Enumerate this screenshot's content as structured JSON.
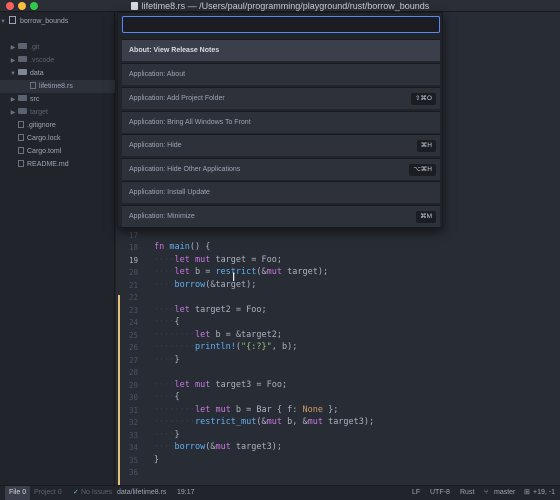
{
  "window": {
    "title": "lifetime8.rs — /Users/paul/programming/playground/rust/borrow_bounds"
  },
  "tree": {
    "root": "borrow_bounds",
    "items": [
      {
        "label": ".git",
        "kind": "folder",
        "dim": true,
        "expanded": false
      },
      {
        "label": ".vscode",
        "kind": "folder",
        "dim": true,
        "expanded": false
      },
      {
        "label": "data",
        "kind": "folder",
        "dim": false,
        "expanded": true
      },
      {
        "label": "lifetime8.rs",
        "kind": "file",
        "dim": false,
        "selected": true
      },
      {
        "label": "src",
        "kind": "folder",
        "dim": false,
        "expanded": false
      },
      {
        "label": "target",
        "kind": "folder",
        "dim": true,
        "expanded": false
      },
      {
        "label": ".gitignore",
        "kind": "file",
        "dim": false
      },
      {
        "label": "Cargo.lock",
        "kind": "file",
        "dim": false
      },
      {
        "label": "Cargo.toml",
        "kind": "file",
        "dim": false
      },
      {
        "label": "README.md",
        "kind": "file",
        "dim": false
      }
    ]
  },
  "palette": {
    "query": "",
    "commands": [
      {
        "label": "About: View Release Notes",
        "shortcut": "",
        "selected": true
      },
      {
        "label": "Application: About",
        "shortcut": ""
      },
      {
        "label": "Application: Add Project Folder",
        "shortcut": "⇧⌘O"
      },
      {
        "label": "Application: Bring All Windows To Front",
        "shortcut": ""
      },
      {
        "label": "Application: Hide",
        "shortcut": "⌘H"
      },
      {
        "label": "Application: Hide Other Applications",
        "shortcut": "⌥⌘H"
      },
      {
        "label": "Application: Install Update",
        "shortcut": ""
      },
      {
        "label": "Application: Minimize",
        "shortcut": "⌘M"
      }
    ]
  },
  "editor": {
    "gutter": [
      "17",
      "18",
      "19",
      "20",
      "21",
      "22",
      "23",
      "24",
      "25",
      "26",
      "27",
      "28",
      "29",
      "30",
      "31",
      "32",
      "33",
      "34",
      "35",
      "36",
      "37"
    ],
    "current_line": "19",
    "lines": [
      "",
      "fn main() {",
      "    let mut target = Foo;",
      "    let b = restrict(&mut target);",
      "    borrow(&target);",
      "",
      "    let target2 = Foo;",
      "    {",
      "        let b = &target2;",
      "        println!(\"{:?}\", b);",
      "    }",
      "",
      "    let mut target3 = Foo;",
      "    {",
      "        let mut b = Bar { f: None };",
      "        restrict_mut(&mut b, &mut target3);",
      "    }",
      "    borrow(&mut target3);",
      "}",
      "",
      ""
    ]
  },
  "statusbar": {
    "file": "File 0",
    "project": "Project 0",
    "issues": "No Issues",
    "path": "data/lifetime8.rs",
    "position": "19:17",
    "line_ending": "LF",
    "encoding": "UTF-8",
    "grammar": "Rust",
    "branch": "master",
    "diff": "+19, -1"
  },
  "colors": {
    "accent": "#568af2",
    "modified": "#e5c07b",
    "added": "#73c990"
  }
}
